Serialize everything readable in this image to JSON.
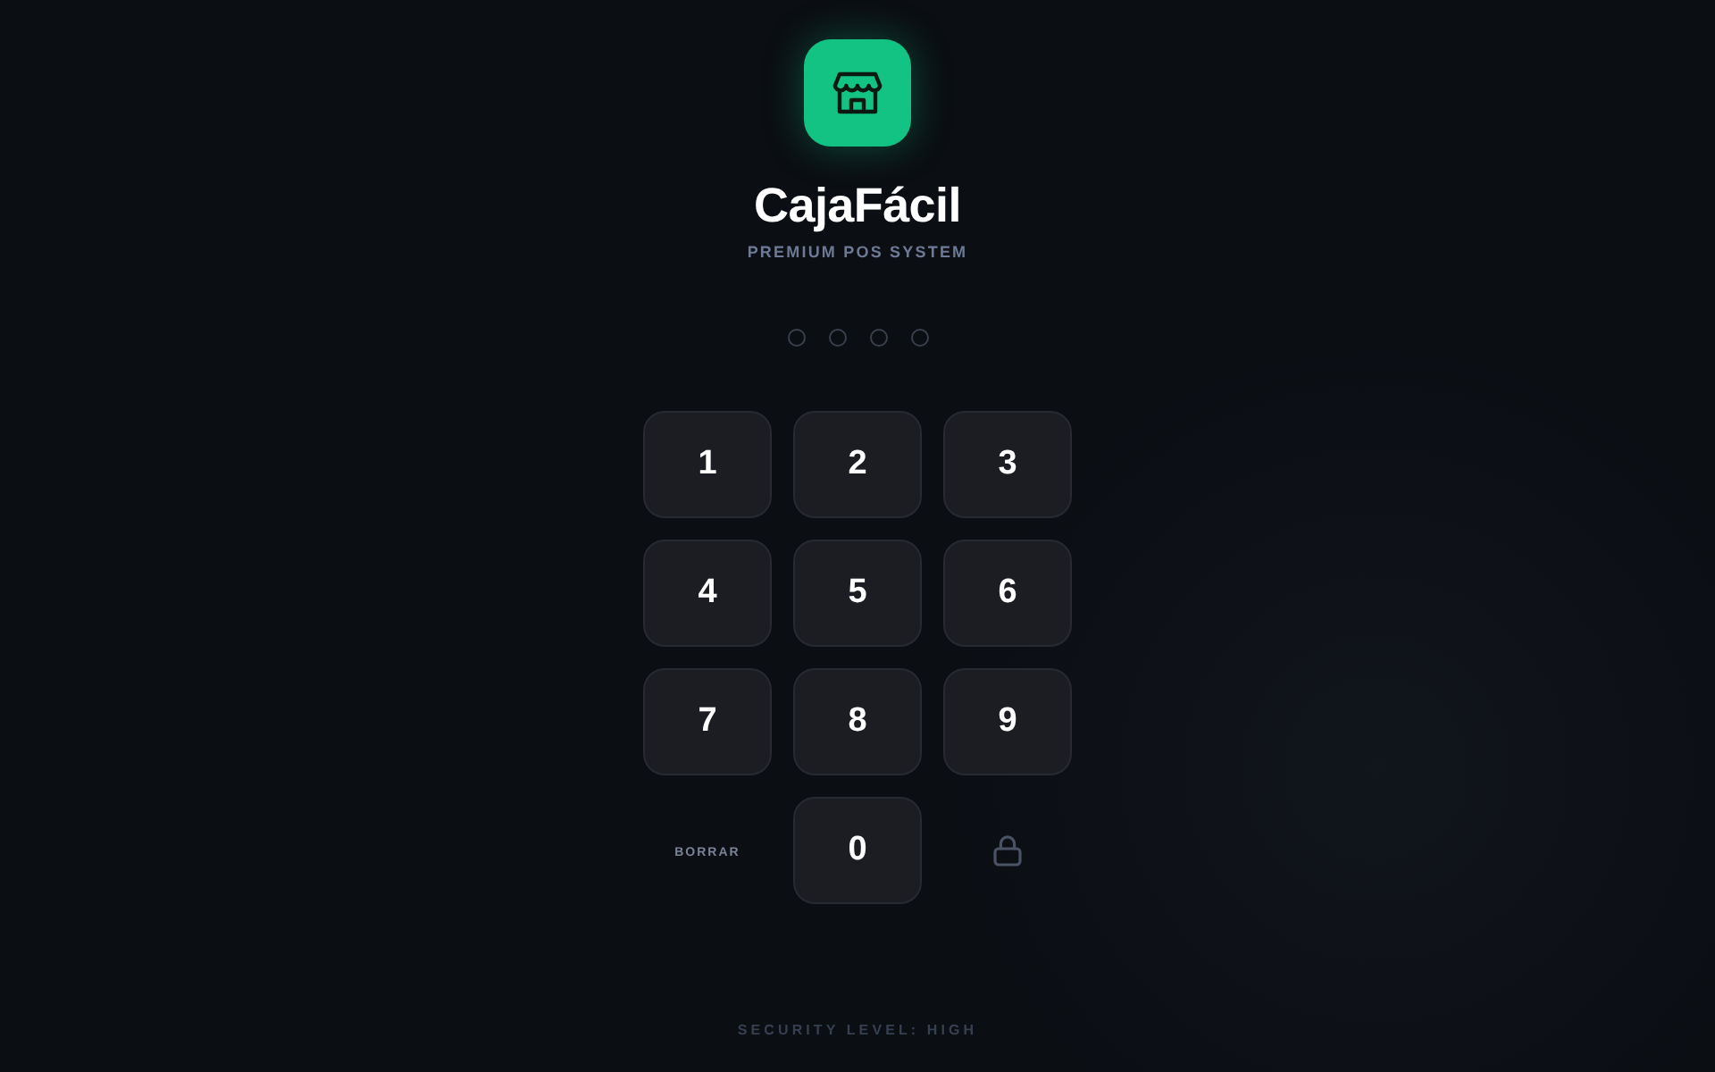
{
  "brand": {
    "title": "CajaFácil",
    "subtitle": "PREMIUM POS SYSTEM"
  },
  "pin": [
    {
      "filled": false
    },
    {
      "filled": false
    },
    {
      "filled": false
    },
    {
      "filled": false
    }
  ],
  "keypad": [
    "1",
    "2",
    "3",
    "4",
    "5",
    "6",
    "7",
    "8",
    "9"
  ],
  "bottom_row": [
    {
      "kind": "text",
      "label": "BORRAR"
    },
    {
      "kind": "digit",
      "label": "0"
    },
    {
      "kind": "lock"
    }
  ],
  "footer": "SECURITY LEVEL: HIGH"
}
